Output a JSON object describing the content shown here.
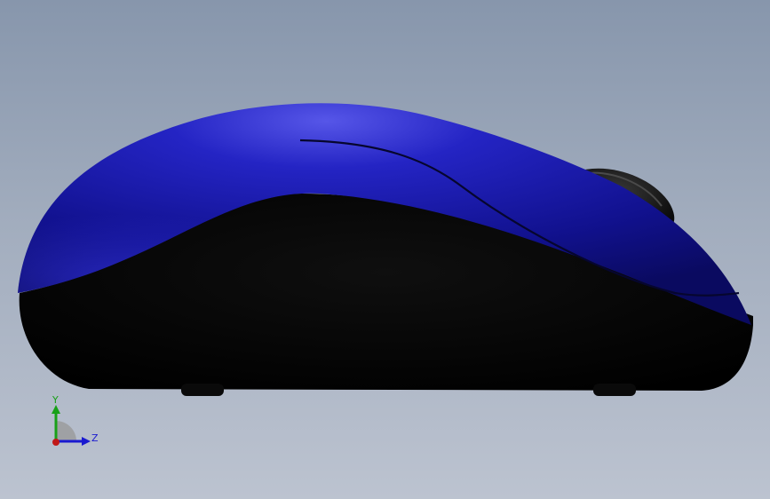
{
  "viewport": {
    "background_top": "#8796ac",
    "background_bottom": "#bcc3d0"
  },
  "model": {
    "shell_color": "#1a1ab8",
    "base_color": "#050505",
    "wheel_color": "#1e1e1e"
  },
  "triad": {
    "y_label": "Y",
    "z_label": "Z",
    "y_color": "#18a018",
    "z_color": "#1a1ad0",
    "x_color": "#c01818",
    "icon": "coordinate-triad-icon"
  }
}
